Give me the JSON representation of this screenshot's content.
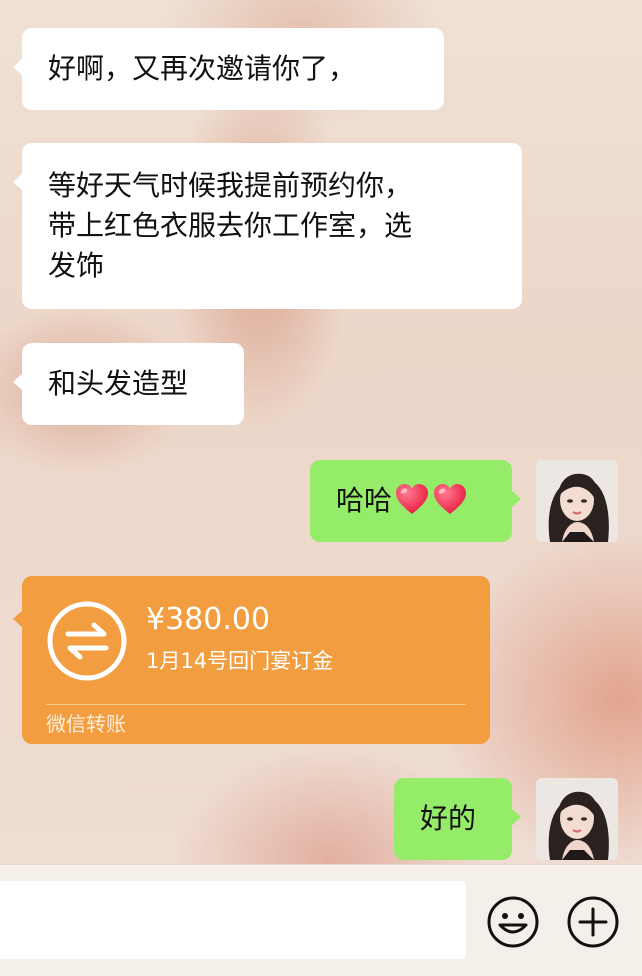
{
  "conversation": {
    "messages": [
      {
        "side": "left",
        "text": "好啊，又再次邀请你了，"
      },
      {
        "side": "left",
        "text": "等好天气时候我提前预约你，\n带上红色衣服去你工作室，选\n发饰"
      },
      {
        "side": "left",
        "text": "和头发造型"
      },
      {
        "side": "right",
        "text": "哈哈",
        "emoji": [
          "red-heart",
          "red-heart"
        ]
      },
      {
        "side": "left",
        "type": "transfer",
        "amount": "¥380.00",
        "note": "1月14号回门宴订金",
        "footer": "微信转账",
        "color": "#f29d3f"
      },
      {
        "side": "right",
        "text": "好的"
      }
    ]
  },
  "input_bar": {
    "message_value": "",
    "icons": [
      "emoji-icon",
      "plus-icon"
    ]
  },
  "colors": {
    "incoming_bubble": "#ffffff",
    "outgoing_bubble": "#95ec69",
    "transfer_card": "#f29d3f"
  }
}
